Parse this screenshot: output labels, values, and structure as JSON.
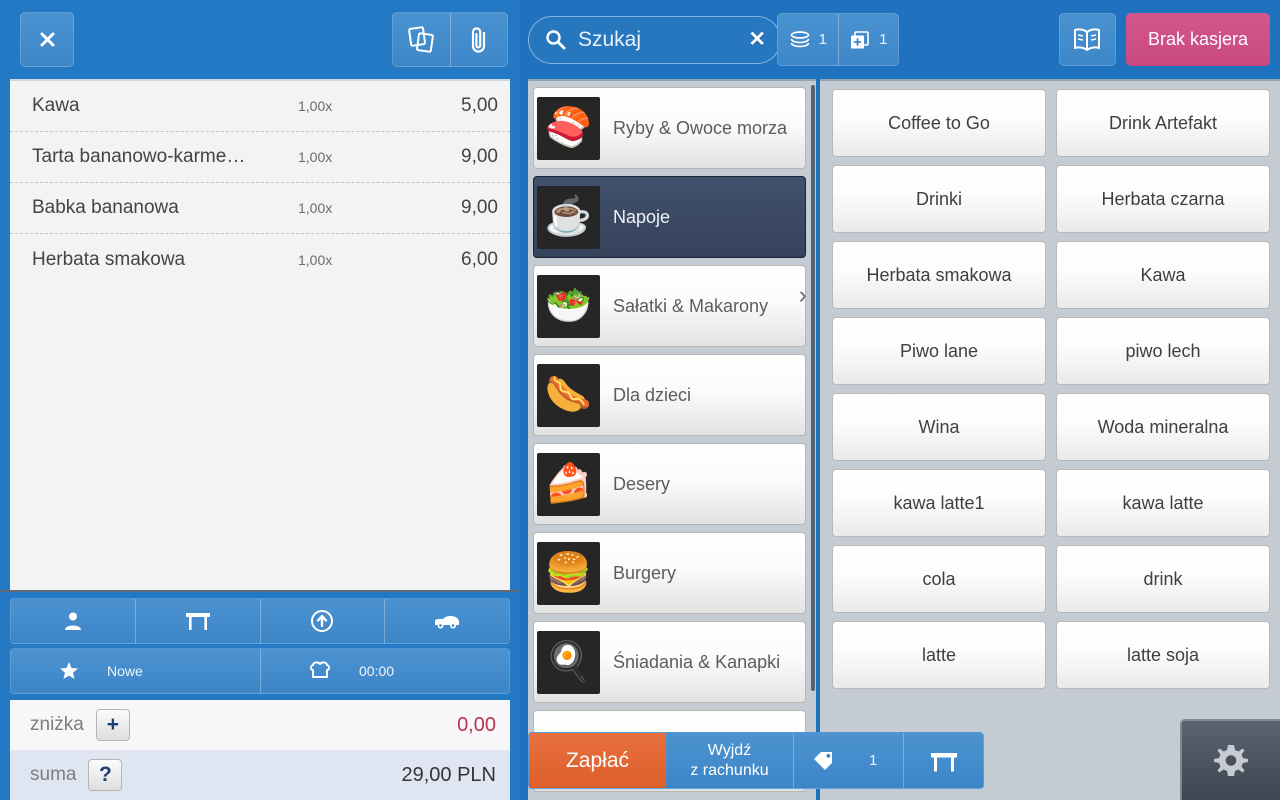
{
  "left": {
    "close_label": "×",
    "header_icons": [
      {
        "name": "cards-icon"
      },
      {
        "name": "paperclip-icon"
      }
    ],
    "receipt_items": [
      {
        "name": "Kawa",
        "qty": "1,00x",
        "price": "5,00"
      },
      {
        "name": "Tarta bananowo-karme…",
        "qty": "1,00x",
        "price": "9,00"
      },
      {
        "name": "Babka bananowa",
        "qty": "1,00x",
        "price": "9,00"
      },
      {
        "name": "Herbata smakowa",
        "qty": "1,00x",
        "price": "6,00"
      }
    ],
    "toolbar_top": [
      {
        "name": "customer-button"
      },
      {
        "name": "table-button"
      },
      {
        "name": "upload-button"
      },
      {
        "name": "delivery-button"
      }
    ],
    "toolbar_bottom": {
      "new_label": "Nowe",
      "timer_label": "00:00"
    },
    "totals": {
      "discount_label": "zniżka",
      "discount_btn": "+",
      "discount_value": "0,00",
      "sum_label": "suma",
      "sum_btn": "?",
      "sum_value": "29,00 PLN"
    }
  },
  "search": {
    "value": "Szukaj",
    "clear_label": "✕"
  },
  "topbar": {
    "counters": [
      {
        "name": "receipts-counter",
        "value": "1"
      },
      {
        "name": "split-bill-counter",
        "value": "1"
      }
    ],
    "book_icon": "book-icon",
    "cashier_label": "Brak kasjera"
  },
  "categories": [
    {
      "label": "Ryby & Owoce morza",
      "emoji": "🍣",
      "selected": false
    },
    {
      "label": "Napoje",
      "emoji": "☕",
      "selected": true
    },
    {
      "label": "Sałatki & Makarony",
      "emoji": "🥗",
      "selected": false
    },
    {
      "label": "Dla dzieci",
      "emoji": "🌭",
      "selected": false
    },
    {
      "label": "Desery",
      "emoji": "🍰",
      "selected": false
    },
    {
      "label": "Burgery",
      "emoji": "🍔",
      "selected": false
    },
    {
      "label": "Śniadania & Kanapki",
      "emoji": "🍳",
      "selected": false
    }
  ],
  "products": [
    "Coffee to Go",
    "Drink Artefakt",
    "Drinki",
    "Herbata czarna",
    "Herbata smakowa",
    "Kawa",
    "Piwo lane",
    "piwo lech",
    "Wina",
    "Woda mineralna",
    "kawa latte1",
    "kawa latte",
    "cola",
    "drink",
    "latte",
    "latte soja"
  ],
  "bottombar": {
    "pay_label": "Zapłać",
    "exit_line1": "Wyjdź",
    "exit_line2": "z rachunku",
    "tag_count": "1",
    "table_icon": "table-icon"
  },
  "colors": {
    "brand_blue": "#1f72bd",
    "panel_blue": "#2379c4",
    "accent_orange": "#e06633",
    "accent_pink": "#cd4e84",
    "selected_navy": "#3b4a65",
    "negative_red": "#b8344e"
  }
}
